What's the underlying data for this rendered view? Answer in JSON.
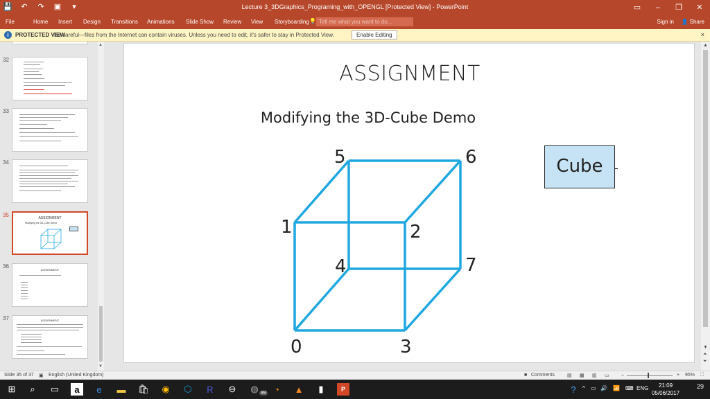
{
  "window": {
    "title": "Lecture 3_3DGraphics_Programing_with_OPENGL [Protected View] - PowerPoint",
    "qat": [
      "save-icon",
      "undo-icon",
      "redo-icon",
      "present-icon",
      "customize-icon"
    ],
    "controls": {
      "ribbon_options": "▭",
      "minimize": "–",
      "restore": "❐",
      "close": "✕"
    }
  },
  "ribbon": {
    "tabs": [
      "File",
      "Home",
      "Insert",
      "Design",
      "Transitions",
      "Animations",
      "Slide Show",
      "Review",
      "View",
      "Storyboarding"
    ],
    "tell_me_placeholder": "Tell me what you want to do...",
    "sign_in": "Sign in",
    "share": "Share"
  },
  "protected_bar": {
    "label": "PROTECTED VIEW",
    "message": "Be careful—files from the Internet can contain viruses. Unless you need to edit, it's safer to stay in Protected View.",
    "button": "Enable Editing",
    "close": "×"
  },
  "thumbnails": [
    {
      "number": "32",
      "title": "",
      "active": false
    },
    {
      "number": "33",
      "title": "",
      "active": false
    },
    {
      "number": "34",
      "title": "",
      "active": false
    },
    {
      "number": "35",
      "title": "ASSIGNMENT",
      "subtitle": "Modifying the 3D-Cube Demo",
      "active": true
    },
    {
      "number": "36",
      "title": "ASSIGNMENT",
      "active": false
    },
    {
      "number": "37",
      "title": "ASSIGNMENT",
      "active": false
    }
  ],
  "slide": {
    "title": "ASSIGNMENT",
    "subtitle": "Modifying the 3D-Cube Demo",
    "box_label": "Cube",
    "box_color": "#c6e3f5",
    "cube_color": "#1ea7e1",
    "vertex_labels": [
      "0",
      "1",
      "2",
      "3",
      "4",
      "5",
      "6",
      "7"
    ]
  },
  "statusbar": {
    "slide_info": "Slide 35 of 37",
    "language": "English (United Kingdom)",
    "comments": "Comments",
    "zoom_out": "–",
    "zoom_in": "+",
    "zoom_level": "95%"
  },
  "taskbar": {
    "tray_lang": "ENG",
    "time": "21:09",
    "date": "05/06/2017",
    "notif_count": "29",
    "badge_count": "99"
  }
}
